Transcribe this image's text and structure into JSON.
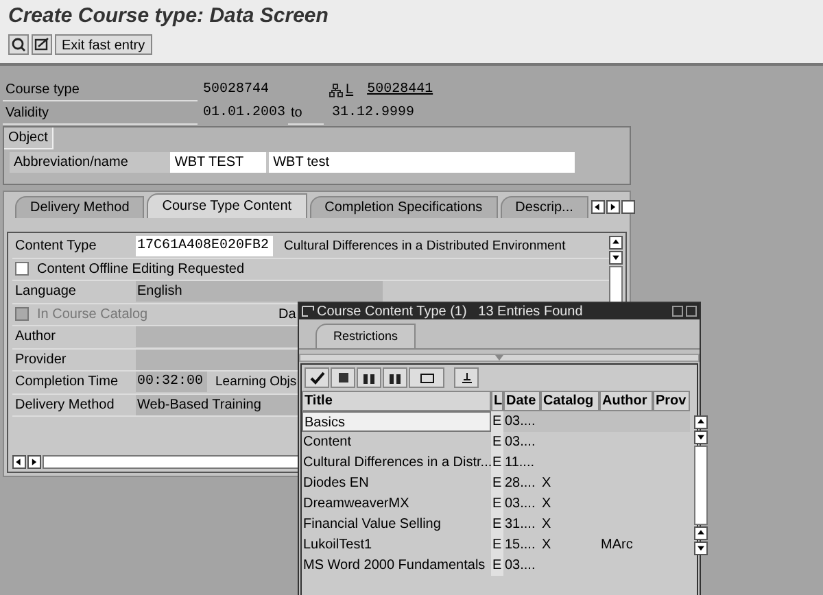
{
  "title": "Create Course type: Data Screen",
  "toolbar": {
    "buttons": [
      {
        "kind": "icon"
      },
      {
        "kind": "icon"
      },
      {
        "kind": "text",
        "label": "Exit fast entry"
      }
    ]
  },
  "header": {
    "course_type": {
      "label": "Course type",
      "value": "50028744",
      "link_prefix": "L",
      "link": "50028441"
    },
    "validity": {
      "label": "Validity",
      "from": "01.01.2003",
      "to_label": "to",
      "to": "31.12.9999"
    }
  },
  "object": {
    "title": "Object",
    "label": "Abbreviation/name",
    "abbreviation": "WBT TEST",
    "name": "WBT test"
  },
  "tabs": [
    {
      "label": "Delivery Method",
      "selected": false
    },
    {
      "label": "Course Type Content",
      "selected": true
    },
    {
      "label": "Completion Specifications",
      "selected": false
    },
    {
      "label": "Descrip...",
      "selected": false
    }
  ],
  "content_rows": [
    {
      "kind": "field",
      "label": "Content Type",
      "value": "17C61A408E020FB2",
      "editable": true,
      "side_text": "Cultural Differences in a Distributed Environment"
    },
    {
      "kind": "checkbox",
      "label": "Content Offline Editing Requested",
      "checked": false,
      "disabled": false
    },
    {
      "kind": "field",
      "label": "Language",
      "value": "English",
      "editable": false
    },
    {
      "kind": "checkbox",
      "label": "In Course Catalog",
      "checked": false,
      "disabled": true,
      "side_text": "Da"
    },
    {
      "kind": "field",
      "label": "Author",
      "editable": false
    },
    {
      "kind": "field",
      "label": "Provider",
      "editable": false
    },
    {
      "kind": "field",
      "label": "Completion Time",
      "value": "00:32:00",
      "editable": false,
      "side_text": "Learning Objs"
    },
    {
      "kind": "field",
      "label": "Delivery Method",
      "value": "Web-Based Training",
      "editable": false
    }
  ],
  "popup": {
    "title": "Course Content Type (1)   13 Entries Found",
    "tab": "Restrictions",
    "columns": [
      "Title",
      "L",
      "Date",
      "Catalog",
      "Author",
      "Prov"
    ],
    "rows": [
      {
        "title": "Basics",
        "l": "E",
        "date": "03....",
        "selected": true
      },
      {
        "title": "Content",
        "l": "E",
        "date": "03....",
        "selected": false
      },
      {
        "title": "Cultural Differences in a Distr...",
        "l": "E",
        "date": "11....",
        "selected": false
      },
      {
        "title": "Diodes EN",
        "l": "E",
        "date": "28....",
        "catalog": "X",
        "selected": false
      },
      {
        "title": "DreamweaverMX",
        "l": "E",
        "date": "03....",
        "catalog": "X",
        "selected": false
      },
      {
        "title": "Financial Value Selling",
        "l": "E",
        "date": "31....",
        "catalog": "X",
        "selected": false
      },
      {
        "title": "LukoilTest1",
        "l": "E",
        "date": "15....",
        "catalog": "X",
        "author": "MArc",
        "selected": false
      },
      {
        "title": "MS Word 2000 Fundamentals",
        "l": "E",
        "date": "03....",
        "selected": false
      }
    ]
  }
}
